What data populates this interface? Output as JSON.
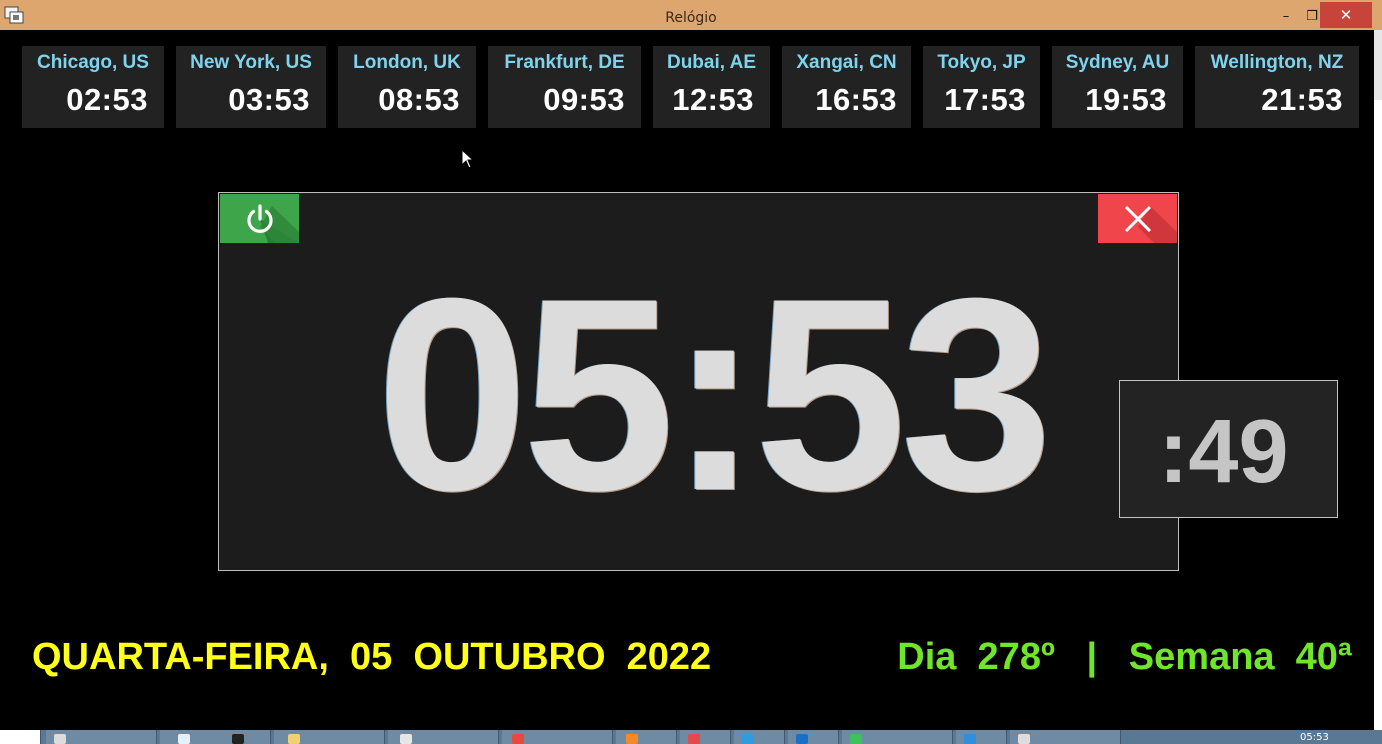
{
  "window": {
    "title": "Relógio",
    "minimize_glyph": "–",
    "restore_glyph": "❐",
    "close_glyph": "✕"
  },
  "world_clocks": [
    {
      "city": "Chicago, US",
      "time": "02:53"
    },
    {
      "city": "New York, US",
      "time": "03:53"
    },
    {
      "city": "London, UK",
      "time": "08:53"
    },
    {
      "city": "Frankfurt, DE",
      "time": "09:53"
    },
    {
      "city": "Dubai, AE",
      "time": "12:53"
    },
    {
      "city": "Xangai, CN",
      "time": "16:53"
    },
    {
      "city": "Tokyo, JP",
      "time": "17:53"
    },
    {
      "city": "Sydney, AU",
      "time": "19:53"
    },
    {
      "city": "Wellington, NZ",
      "time": "21:53"
    }
  ],
  "main_clock": {
    "time": "05:53",
    "seconds": ":49",
    "power_icon": "power-icon",
    "close_icon": "close-x-icon"
  },
  "date_line": {
    "text": "QUARTA-FEIRA,  05  OUTUBRO  2022"
  },
  "day_week": {
    "text": "Dia  278º   |   Semana  40ª"
  },
  "taskbar": {
    "clock": "05:53"
  },
  "colors": {
    "title_bar": "#dda66f",
    "city_name": "#7fd3ee",
    "date_yellow": "#ffff1a",
    "day_green": "#6fe62a",
    "power_green": "#3ea54a",
    "close_red": "#f1454c",
    "clock_digits": "#dcdcdc"
  }
}
